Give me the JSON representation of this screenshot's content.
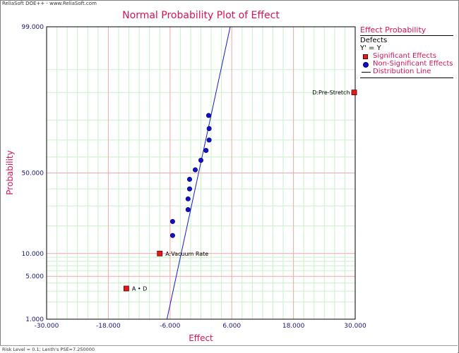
{
  "header": {
    "caption": "ReliaSoft DOE++ - www.ReliaSoft.com"
  },
  "footer": {
    "caption": "Risk Level = 0.1; Lenth's PSE=7.250000"
  },
  "chart_data": {
    "type": "scatter",
    "title": "Normal Probability Plot of Effect",
    "xlabel": "Effect",
    "ylabel": "Probability",
    "xlim": [
      -30,
      30
    ],
    "ylim": [
      1,
      99
    ],
    "y_scale": "normal-probability",
    "x_ticks": [
      -30,
      -18,
      -6,
      6,
      18,
      30
    ],
    "x_tick_labels": [
      "-30.000",
      "-18.000",
      "-6.000",
      "6.000",
      "18.000",
      "30.000"
    ],
    "y_ticks": [
      1,
      5,
      10,
      50,
      99
    ],
    "y_tick_labels": [
      "1.000",
      "5.000",
      "10.000",
      "50.000",
      "99.000"
    ],
    "grid": true,
    "legend": {
      "placement": "right",
      "title": "Effect Probability",
      "subtitle": "Defects",
      "formula": "Y' = Y",
      "entries": [
        "Significant Effects",
        "Non-Significant Effects",
        "Distribution Line"
      ]
    },
    "significant_points": [
      {
        "x": -14.5,
        "y": 3.3,
        "label": "A • D"
      },
      {
        "x": -8.0,
        "y": 10.0,
        "label": "A:Vacuum Rate"
      },
      {
        "x": 29.8,
        "y": 90.0,
        "label": "D:Pre-Stretch"
      }
    ],
    "non_significant_points": [
      {
        "x": -5.5,
        "y": 16.0
      },
      {
        "x": -5.5,
        "y": 22.0
      },
      {
        "x": -2.5,
        "y": 28.0
      },
      {
        "x": -2.5,
        "y": 34.0
      },
      {
        "x": -2.2,
        "y": 40.0
      },
      {
        "x": -2.2,
        "y": 46.0
      },
      {
        "x": -1.1,
        "y": 52.0
      },
      {
        "x": 0.0,
        "y": 58.0
      },
      {
        "x": 1.0,
        "y": 64.0
      },
      {
        "x": 1.6,
        "y": 70.0
      },
      {
        "x": 1.6,
        "y": 76.0
      },
      {
        "x": 1.5,
        "y": 82.0
      }
    ],
    "distribution_line": {
      "x1": -6.6,
      "y1": 1.0,
      "x2": 5.7,
      "y2": 99.0
    }
  },
  "colors": {
    "title": "#d4145a",
    "tick_labels": "#14147a",
    "minor_grid": "#c8f0c8",
    "major_grid": "#f4a6a6",
    "significant_marker": "#e31a1c",
    "non_significant_marker": "#1010c8",
    "distribution_line": "#1a1ac0"
  }
}
